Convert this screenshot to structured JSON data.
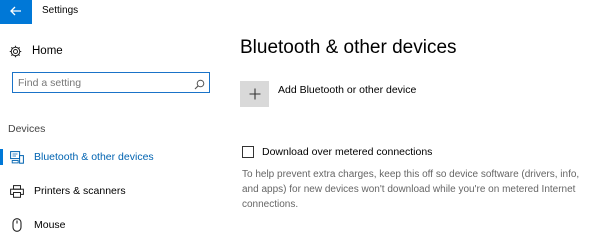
{
  "window": {
    "title": "Settings",
    "accent_color": "#0078d7"
  },
  "sidebar": {
    "home_label": "Home",
    "search": {
      "placeholder": "Find a setting",
      "value": ""
    },
    "section_label": "Devices",
    "items": [
      {
        "label": "Bluetooth & other devices",
        "icon": "bluetooth-devices-icon",
        "active": true
      },
      {
        "label": "Printers & scanners",
        "icon": "printer-icon",
        "active": false
      },
      {
        "label": "Mouse",
        "icon": "mouse-icon",
        "active": false
      }
    ]
  },
  "main": {
    "title": "Bluetooth & other devices",
    "add_device_label": "Add Bluetooth or other device",
    "metered": {
      "label": "Download over metered connections",
      "checked": false,
      "help": "To help prevent extra charges, keep this off so device software (drivers, info, and apps) for new devices won't download while you're on metered Internet connections."
    }
  }
}
